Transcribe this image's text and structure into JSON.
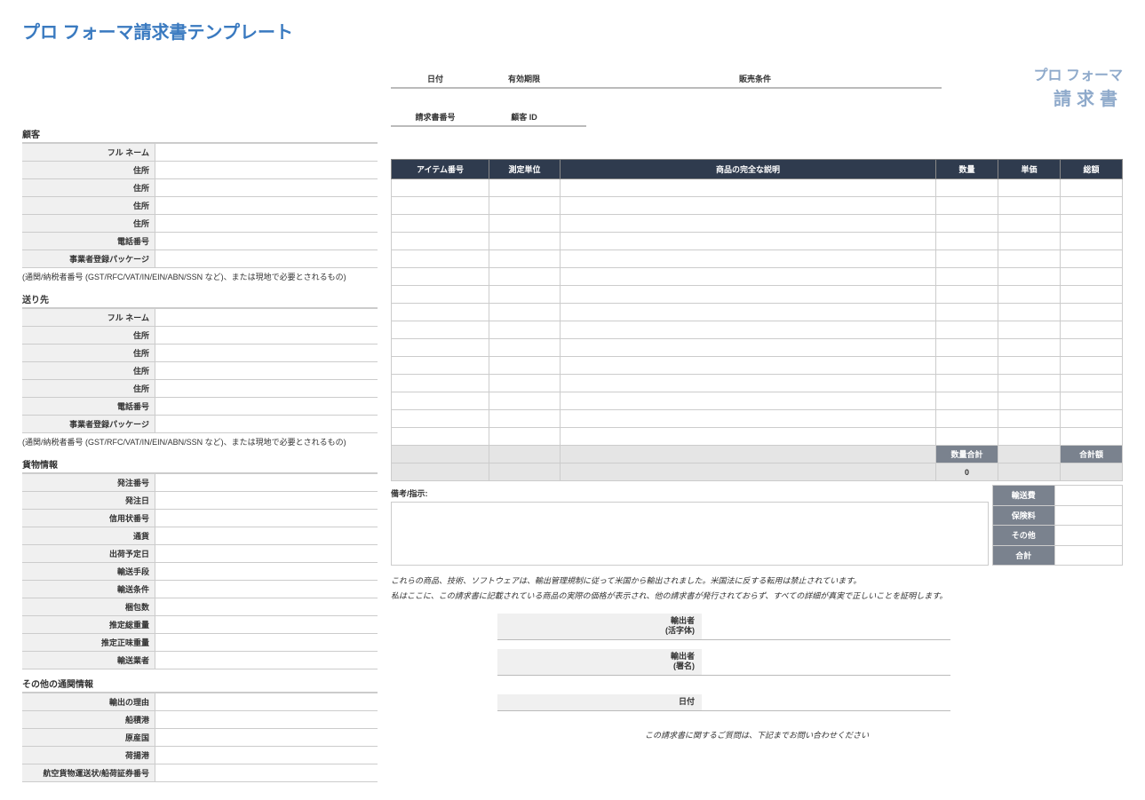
{
  "title": "プロ フォーマ請求書テンプレート",
  "brand": {
    "line1": "プロ フォーマ",
    "line2": "請求書"
  },
  "meta": {
    "date_label": "日付",
    "expiry_label": "有効期限",
    "terms_label": "販売条件",
    "invoice_no_label": "請求書番号",
    "customer_id_label": "顧客 ID"
  },
  "sections": {
    "customer": "顧客",
    "shipto": "送り先",
    "freight": "貨物情報",
    "customs": "その他の通関情報"
  },
  "customer_fields": {
    "fullname": "フル ネーム",
    "addr1": "住所",
    "addr2": "住所",
    "addr3": "住所",
    "addr4": "住所",
    "phone": "電話番号",
    "reg": "事業者登録パッケージ"
  },
  "reg_note": "(通関/納税者番号 (GST/RFC/VAT/IN/EIN/ABN/SSN など)、または現地で必要とされるもの)",
  "shipto_fields": {
    "fullname": "フル ネーム",
    "addr1": "住所",
    "addr2": "住所",
    "addr3": "住所",
    "addr4": "住所",
    "phone": "電話番号",
    "reg": "事業者登録パッケージ"
  },
  "freight_fields": {
    "po": "発注番号",
    "podate": "発注日",
    "lc": "信用状番号",
    "currency": "通貨",
    "shipdate": "出荷予定日",
    "mode": "輸送手段",
    "terms": "輸送条件",
    "pkgs": "梱包数",
    "gross": "推定総重量",
    "net": "推定正味重量",
    "carrier": "輸送業者"
  },
  "customs_fields": {
    "reason": "輸出の理由",
    "loadport": "船積港",
    "origin": "原産国",
    "discharge": "荷揚港",
    "awb": "航空貨物運送状/船荷証券番号"
  },
  "items_header": {
    "item": "アイテム番号",
    "unit": "測定単位",
    "desc": "商品の完全な説明",
    "qty": "数量",
    "price": "単価",
    "total": "総額"
  },
  "totals": {
    "qty_total_label": "数量合計",
    "qty_total_value": "0",
    "amount_total_label": "合計額"
  },
  "remarks_label": "備考/指示:",
  "charges": {
    "shipping": "輸送費",
    "insurance": "保険料",
    "other": "その他",
    "grand": "合計"
  },
  "decl1": "これらの商品、技術、ソフトウェアは、輸出管理規制に従って米国から輸出されました。米国法に反する転用は禁止されています。",
  "decl2": "私はここに、この請求書に記載されている商品の実際の価格が表示され、他の請求書が発行されておらず、すべての詳細が真実で正しいことを証明します。",
  "sig": {
    "exporter_print_l1": "輸出者",
    "exporter_print_l2": "(活字体)",
    "exporter_sign_l1": "輸出者",
    "exporter_sign_l2": "(署名)",
    "date": "日付"
  },
  "footer": "この請求書に関するご質問は、下記までお問い合わせください"
}
